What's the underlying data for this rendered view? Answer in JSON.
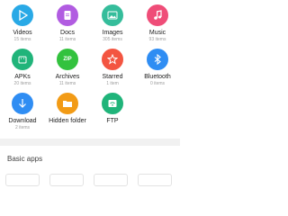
{
  "categories": [
    {
      "label": "Videos",
      "count": "15 items",
      "color": "#29a9e6",
      "icon": "play-icon"
    },
    {
      "label": "Docs",
      "count": "11 items",
      "color": "#b15ce1",
      "icon": "document-icon"
    },
    {
      "label": "Images",
      "count": "305 items",
      "color": "#35bd9b",
      "icon": "image-icon"
    },
    {
      "label": "Music",
      "count": "93 items",
      "color": "#ef4d78",
      "icon": "music-note-icon"
    },
    {
      "label": "APKs",
      "count": "20 items",
      "color": "#20b47a",
      "icon": "android-icon"
    },
    {
      "label": "Archives",
      "count": "11 items",
      "color": "#33c23e",
      "icon": "zip-icon"
    },
    {
      "label": "Starred",
      "count": "1 item",
      "color": "#f35541",
      "icon": "star-icon"
    },
    {
      "label": "Bluetooth",
      "count": "0 items",
      "color": "#2f8df3",
      "icon": "bluetooth-icon"
    },
    {
      "label": "Download",
      "count": "2 items",
      "color": "#2f8df3",
      "icon": "download-icon"
    },
    {
      "label": "Hidden folder",
      "count": "",
      "color": "#f29b16",
      "icon": "folder-icon"
    },
    {
      "label": "FTP",
      "count": "",
      "color": "#20b47a",
      "icon": "wifi-icon"
    }
  ],
  "zip_glyph": "ZIP",
  "section": {
    "title": "Basic apps"
  }
}
